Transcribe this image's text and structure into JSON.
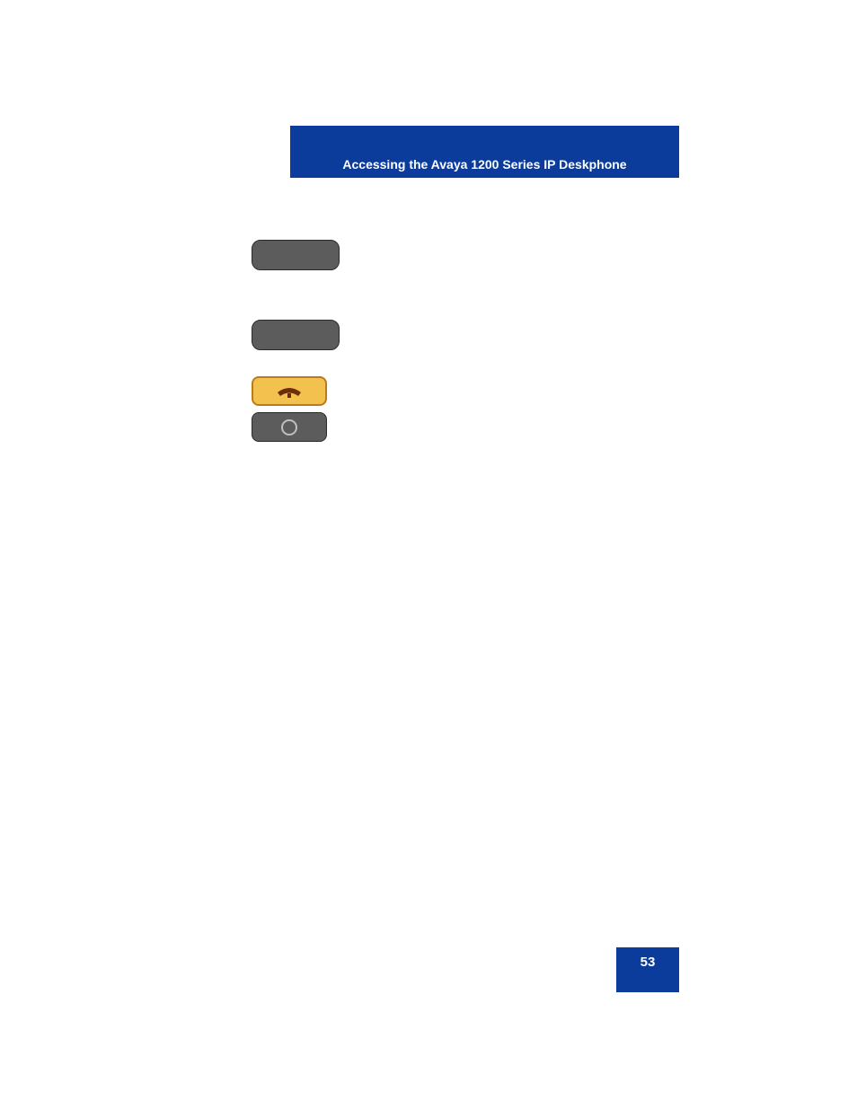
{
  "header": {
    "title": "Accessing the Avaya 1200 Series IP Deskphone"
  },
  "buttons": {
    "softkey1": "",
    "softkey2": "",
    "hangup": "hangup-icon",
    "circle": "circle-icon"
  },
  "page_number": "53"
}
